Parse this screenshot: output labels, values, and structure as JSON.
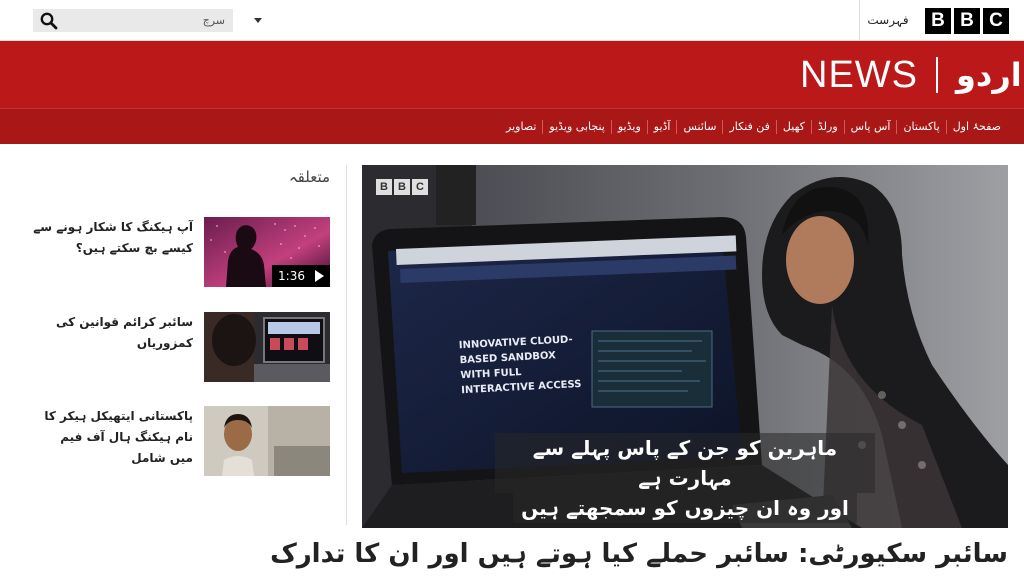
{
  "topbar": {
    "search_placeholder": "سرچ",
    "menu_label": "فہرست",
    "bbc_letters": [
      "B",
      "B",
      "C"
    ]
  },
  "header": {
    "news": "NEWS",
    "language": "اردو"
  },
  "nav": {
    "items": [
      {
        "label": "صفحۂ اول"
      },
      {
        "label": "پاکستان"
      },
      {
        "label": "آس پاس"
      },
      {
        "label": "ورلڈ"
      },
      {
        "label": "کھیل"
      },
      {
        "label": "فن فنکار"
      },
      {
        "label": "سائنس"
      },
      {
        "label": "آڈیو"
      },
      {
        "label": "ویڈیو"
      },
      {
        "label": "پنجابی ویڈیو"
      },
      {
        "label": "تصاویر"
      }
    ]
  },
  "related": {
    "title": "متعلقہ",
    "items": [
      {
        "text": "آپ ہیکنگ کا شکار ہونے سے کیسے بچ سکتے ہیں؟",
        "duration": "1:36"
      },
      {
        "text": "سائبر کرائم قوانین کی کمزوریاں"
      },
      {
        "text": "پاکستانی ایتھیکل ہیکر کا نام ہیکنگ ہال آف فیم میں شامل"
      }
    ]
  },
  "hero": {
    "bbc_letters": [
      "B",
      "B",
      "C"
    ],
    "caption_line1": "ماہرین کو جن کے پاس پہلے سے مہارت ہے",
    "caption_line2": "اور وہ ان چیزوں کو سمجھتے ہیں",
    "screen_text": "INNOVATIVE CLOUD-BASED SANDBOX WITH FULL INTERACTIVE ACCESS"
  },
  "article": {
    "headline": "سائبر سکیورٹی: سائبر حملے کیا ہوتے ہیں اور ان کا تدارک"
  },
  "colors": {
    "brand_red": "#bb1919",
    "nav_red": "#a91717"
  }
}
